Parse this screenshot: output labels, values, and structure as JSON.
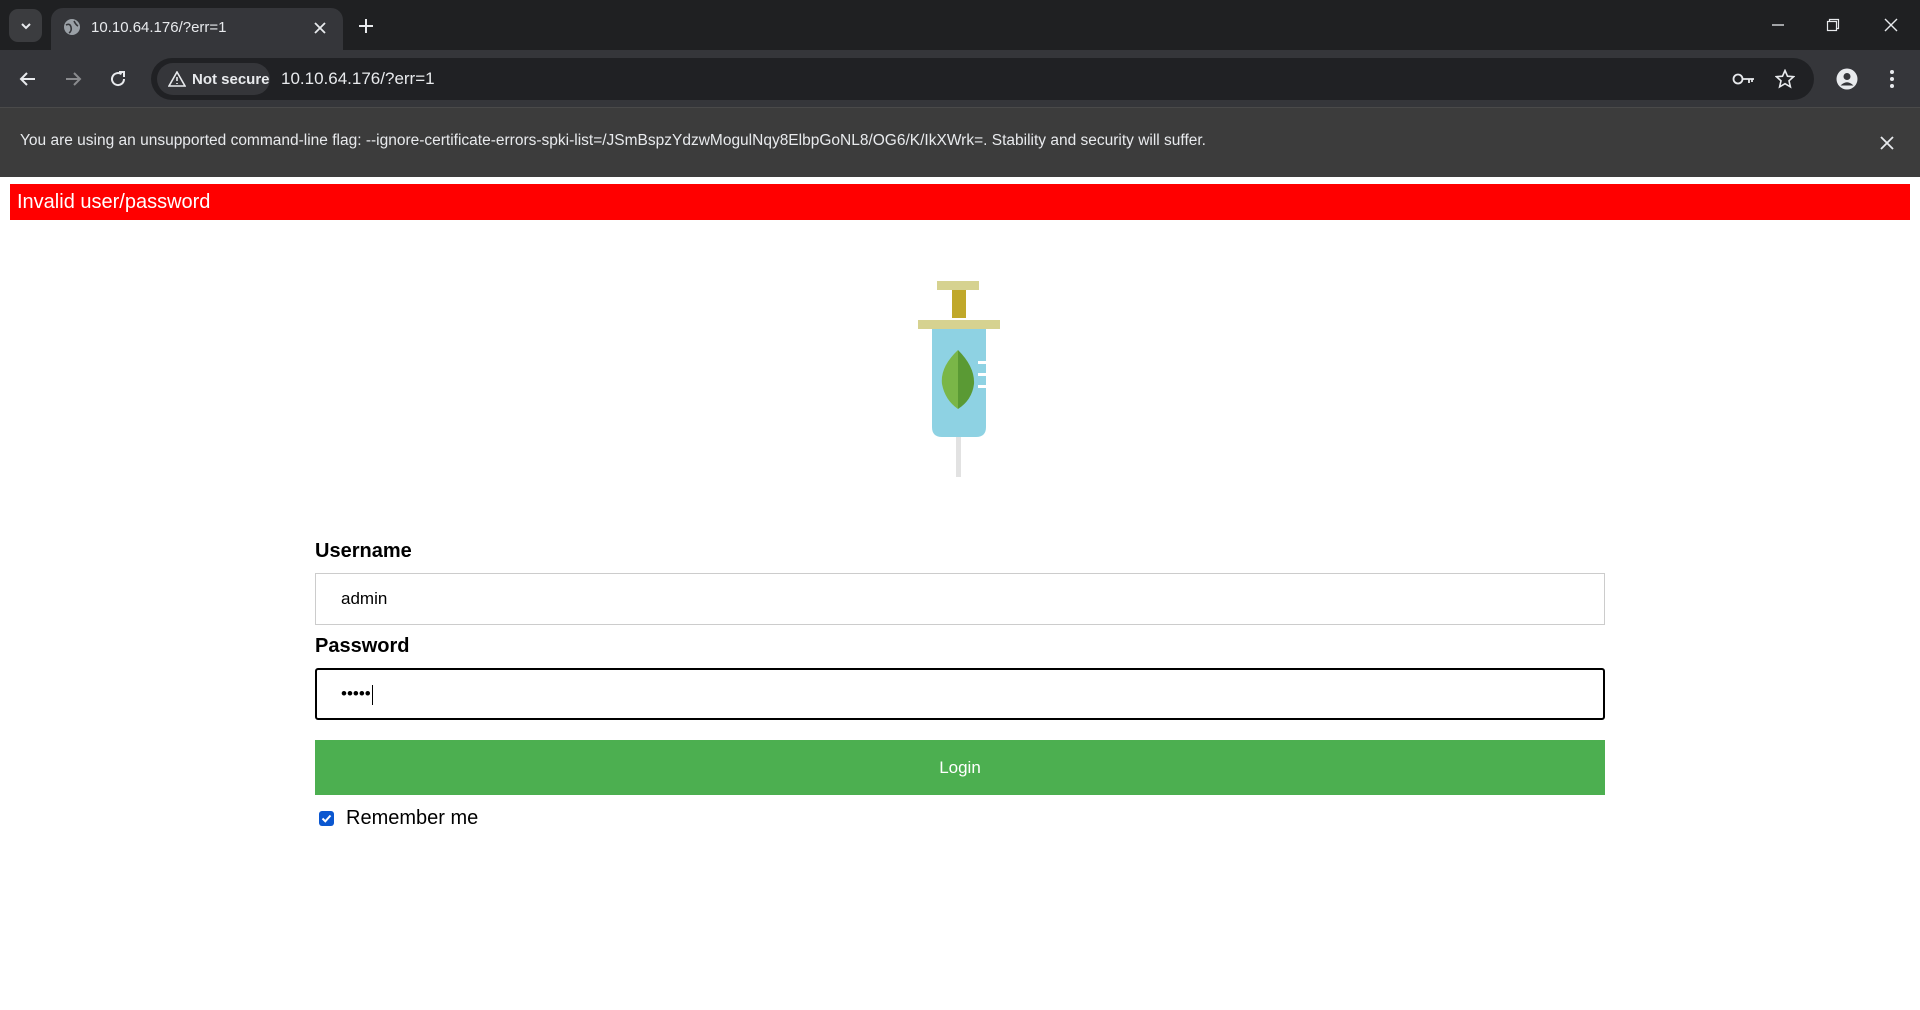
{
  "browser": {
    "tab_title": "10.10.64.176/?err=1",
    "security_label": "Not secure",
    "url": "10.10.64.176/?err=1",
    "infobar_text": "You are using an unsupported command-line flag: --ignore-certificate-errors-spki-list=/JSmBspzYdzwMogulNqy8ElbpGoNL8/OG6/K/IkXWrk=. Stability and security will suffer."
  },
  "page": {
    "error_message": "Invalid user/password",
    "username_label": "Username",
    "username_value": "admin",
    "password_label": "Password",
    "password_value": "•••••",
    "login_label": "Login",
    "remember_label": "Remember me",
    "remember_checked": true
  },
  "colors": {
    "error_banner": "#ff0000",
    "login_button": "#4caf50",
    "checkbox": "#0b57d0"
  },
  "icons": [
    "tab-search-icon",
    "globe-icon",
    "close-icon",
    "plus-icon",
    "minimize-icon",
    "restore-icon",
    "back-arrow-icon",
    "forward-arrow-icon",
    "reload-icon",
    "warning-icon",
    "key-icon",
    "star-icon",
    "profile-icon",
    "menu-dots-icon",
    "syringe-leaf-logo"
  ]
}
